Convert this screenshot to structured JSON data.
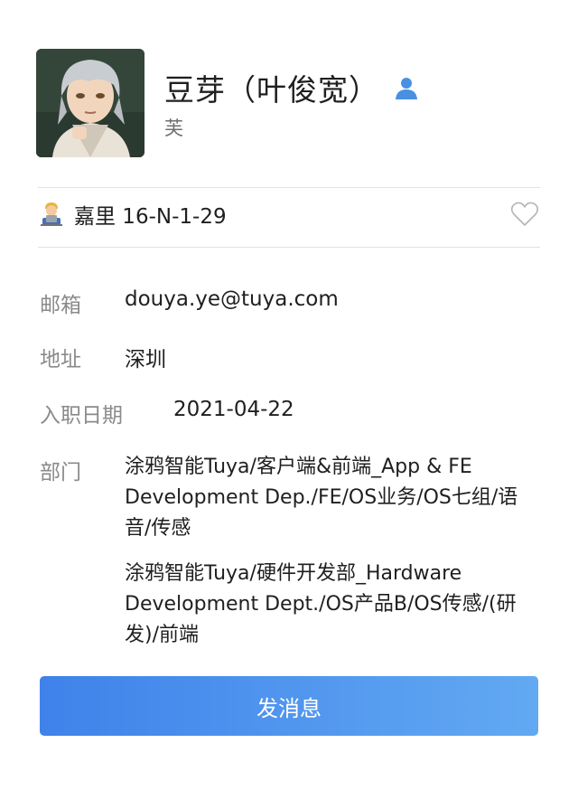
{
  "profile": {
    "name": "豆芽（叶俊宽）",
    "subname": "芙",
    "avatar_icon": "avatar-image",
    "person_icon": "person-icon",
    "accent_color": "#4a90e2"
  },
  "location": {
    "emoji": "technologist-emoji",
    "text": "嘉里 16-N-1-29",
    "favorite_icon": "heart-outline-icon"
  },
  "fields": {
    "email_label": "邮箱",
    "email_value": "douya.ye@tuya.com",
    "address_label": "地址",
    "address_value": "深圳",
    "hire_date_label": "入职日期",
    "hire_date_value": "2021-04-22",
    "department_label": "部门",
    "departments": [
      "涂鸦智能Tuya/客户端&前端_App & FE Development Dep./FE/OS业务/OS七组/语音/传感",
      "涂鸦智能Tuya/硬件开发部_Hardware Development Dept./OS产品B/OS传感/(研发)/前端"
    ]
  },
  "actions": {
    "send_message": "发消息"
  }
}
